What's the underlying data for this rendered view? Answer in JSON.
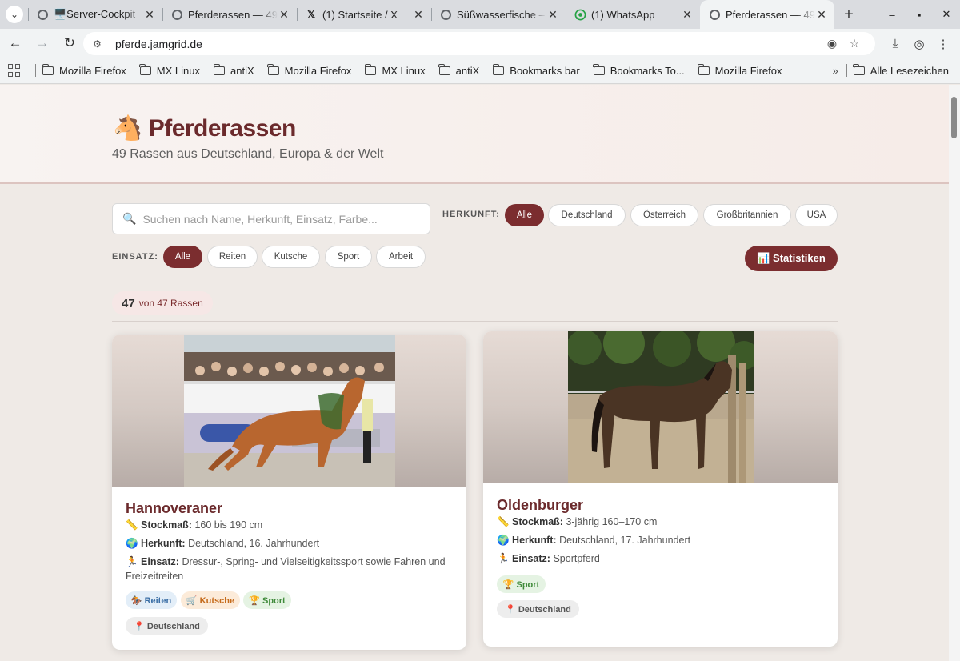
{
  "browser": {
    "tabs": [
      {
        "title": "🖥️Server-Cockpit",
        "icon": "globe-icon",
        "active": false
      },
      {
        "title": "Pferderassen — 49",
        "icon": "globe-icon",
        "active": false
      },
      {
        "title": "(1) Startseite / X",
        "icon": "x-logo-icon",
        "active": false
      },
      {
        "title": "Süßwasserfische –",
        "icon": "globe-icon",
        "active": false
      },
      {
        "title": "(1) WhatsApp",
        "icon": "whatsapp-icon",
        "active": false
      },
      {
        "title": "Pferderassen — 49",
        "icon": "globe-icon",
        "active": true
      }
    ],
    "url": "pferde.jamgrid.de",
    "bookmarks": [
      "Mozilla Firefox",
      "MX Linux",
      "antiX",
      "Mozilla Firefox",
      "MX Linux",
      "antiX",
      "Bookmarks bar",
      "Bookmarks To...",
      "Mozilla Firefox"
    ],
    "bookmarks_more": "»",
    "all_bookmarks": "Alle Lesezeichen"
  },
  "page": {
    "title": "🐴 Pferderassen",
    "subtitle": "49 Rassen aus Deutschland, Europa & der Welt",
    "search_placeholder": "Suchen nach Name, Herkunft, Einsatz, Farbe...",
    "origin_label": "HERKUNFT:",
    "origin_filters": [
      "Alle",
      "Deutschland",
      "Österreich",
      "Großbritannien",
      "USA"
    ],
    "origin_selected": "Alle",
    "use_label": "EINSATZ:",
    "use_filters": [
      "Alle",
      "Reiten",
      "Kutsche",
      "Sport",
      "Arbeit"
    ],
    "use_selected": "Alle",
    "stats_button": "📊 Statistiken",
    "count_number": "47",
    "count_text": "von 47 Rassen",
    "accent_color": "#7b2d2f"
  },
  "cards": [
    {
      "name": "Hannoveraner",
      "height_label": "📏 Stockmaß:",
      "height": "160 bis 190 cm",
      "origin_label": "🌍 Herkunft:",
      "origin": "Deutschland, 16. Jahrhundert",
      "use_label": "🏃 Einsatz:",
      "use": "Dressur-, Spring- und Vielseitigkeitssport sowie Fahren und Freizeitreiten",
      "tags": [
        "🏇 Reiten",
        "🛒 Kutsche",
        "🏆 Sport"
      ],
      "country": "📍 Deutschland"
    },
    {
      "name": "Oldenburger",
      "height_label": "📏 Stockmaß:",
      "height": "3-jährig 160–170 cm",
      "origin_label": "🌍 Herkunft:",
      "origin": "Deutschland, 17. Jahrhundert",
      "use_label": "🏃 Einsatz:",
      "use": "Sportpferd",
      "tags": [
        "🏆 Sport"
      ],
      "country": "📍 Deutschland"
    }
  ]
}
